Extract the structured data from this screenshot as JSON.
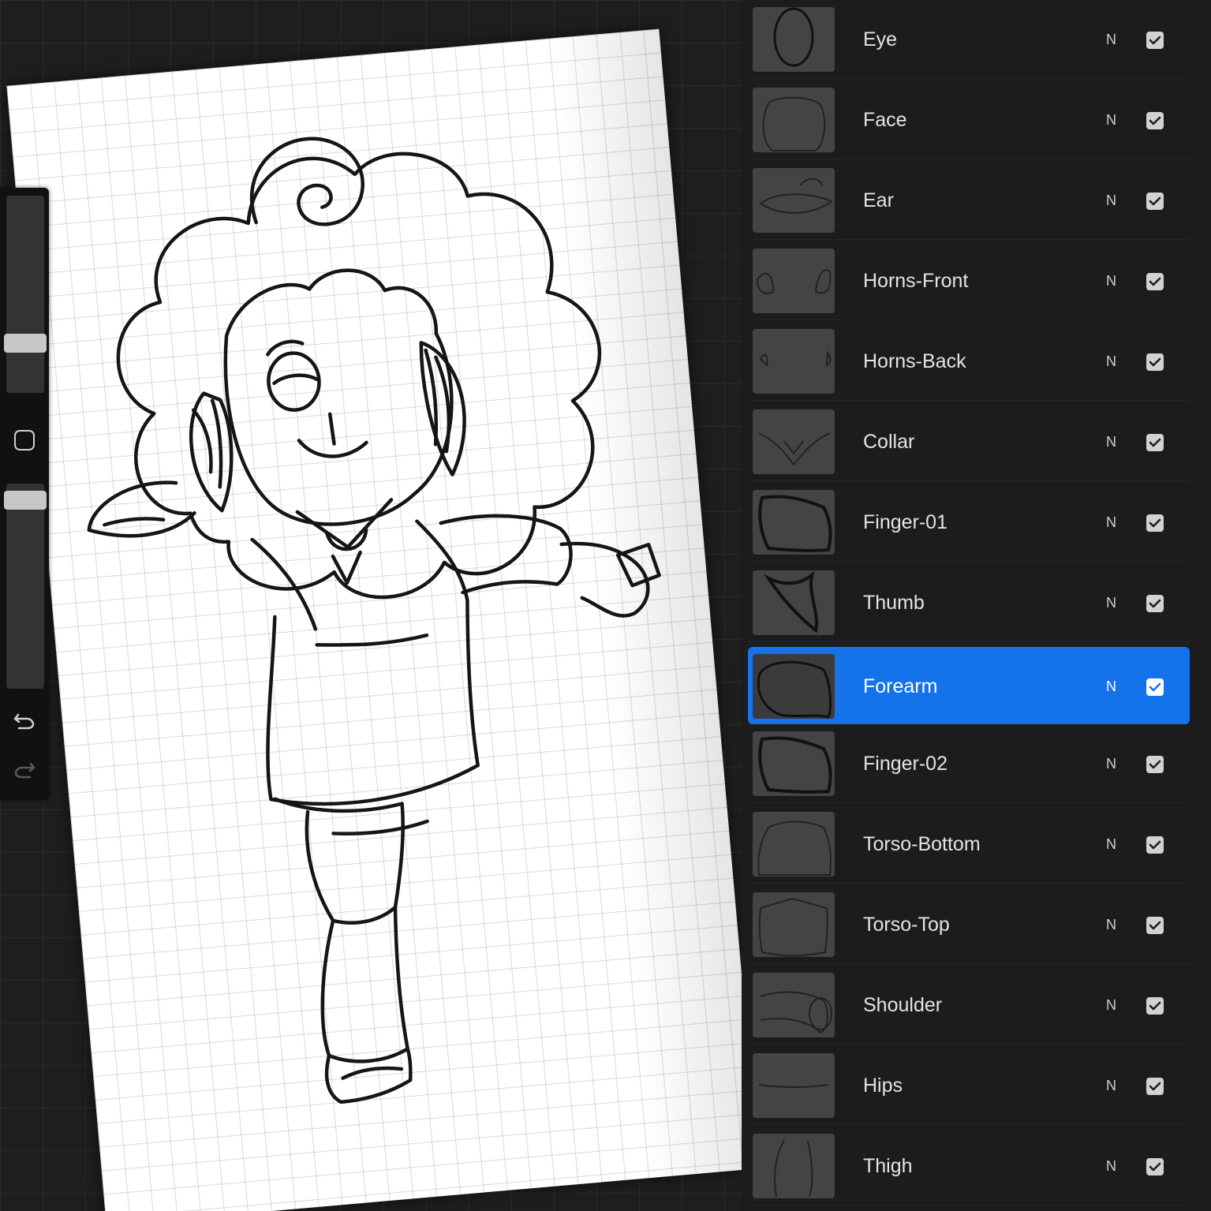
{
  "layers_panel": {
    "selected_color": "#1473ea",
    "layers": [
      {
        "name": "Eye",
        "blend": "N",
        "visible": true,
        "selected": false,
        "thumb_icon": "eye-outline"
      },
      {
        "name": "Face",
        "blend": "N",
        "visible": true,
        "selected": false,
        "thumb_icon": "face-outline"
      },
      {
        "name": "Ear",
        "blend": "N",
        "visible": true,
        "selected": false,
        "thumb_icon": "ear-outline"
      },
      {
        "name": "Horns-Front",
        "blend": "N",
        "visible": true,
        "selected": false,
        "thumb_icon": "horns-front-outline"
      },
      {
        "name": "Horns-Back",
        "blend": "N",
        "visible": true,
        "selected": false,
        "thumb_icon": "horns-back-outline"
      },
      {
        "name": "Collar",
        "blend": "N",
        "visible": true,
        "selected": false,
        "thumb_icon": "collar-outline"
      },
      {
        "name": "Finger-01",
        "blend": "N",
        "visible": true,
        "selected": false,
        "thumb_icon": "finger-outline"
      },
      {
        "name": "Thumb",
        "blend": "N",
        "visible": true,
        "selected": false,
        "thumb_icon": "thumb-outline"
      },
      {
        "name": "Forearm",
        "blend": "N",
        "visible": true,
        "selected": true,
        "thumb_icon": "forearm-outline"
      },
      {
        "name": "Finger-02",
        "blend": "N",
        "visible": true,
        "selected": false,
        "thumb_icon": "finger-outline"
      },
      {
        "name": "Torso-Bottom",
        "blend": "N",
        "visible": true,
        "selected": false,
        "thumb_icon": "torso-bottom-outline"
      },
      {
        "name": "Torso-Top",
        "blend": "N",
        "visible": true,
        "selected": false,
        "thumb_icon": "torso-top-outline"
      },
      {
        "name": "Shoulder",
        "blend": "N",
        "visible": true,
        "selected": false,
        "thumb_icon": "shoulder-outline"
      },
      {
        "name": "Hips",
        "blend": "N",
        "visible": true,
        "selected": false,
        "thumb_icon": "hips-outline"
      },
      {
        "name": "Thigh",
        "blend": "N",
        "visible": true,
        "selected": false,
        "thumb_icon": "thigh-outline"
      }
    ]
  },
  "toolbar": {
    "brush_size_level": 0.23,
    "opacity_level": 0.94,
    "icons": [
      "modify-square-icon",
      "undo-icon",
      "redo-icon"
    ]
  },
  "canvas": {
    "background": "grid-paper",
    "artwork": "lineart-sheep-character-sketch"
  }
}
